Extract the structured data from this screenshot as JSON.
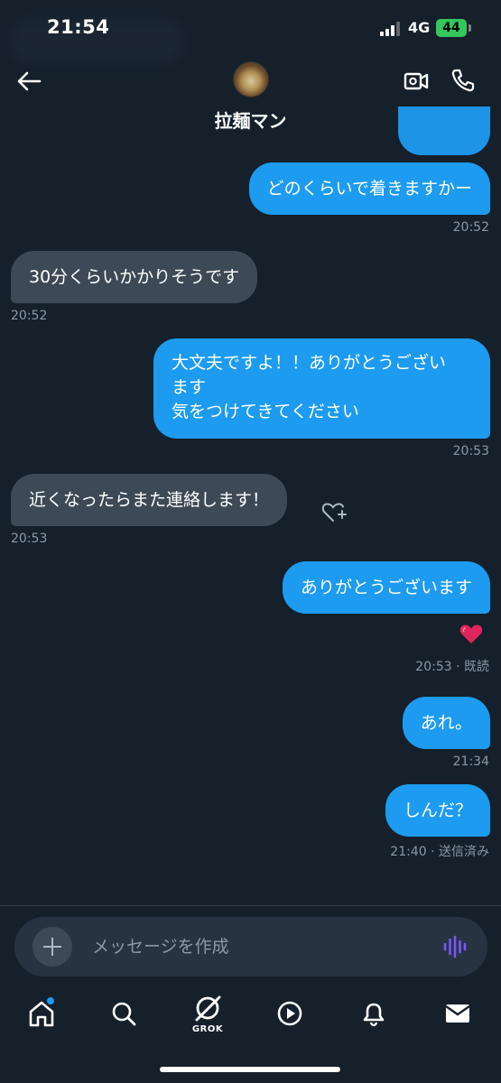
{
  "status_bar": {
    "time": "21:54",
    "network": "4G",
    "battery": "44"
  },
  "header": {
    "contact_name": "拉麺マン",
    "avatar_icon": "ramen-avatar",
    "back_icon": "arrow-left-icon",
    "video_icon": "video-call-icon",
    "phone_icon": "phone-icon"
  },
  "messages": [
    {
      "direction": "sent",
      "text": "どのくらいで着きますかー",
      "time": "20:52"
    },
    {
      "direction": "received",
      "text": "30分くらいかかりそうです",
      "time": "20:52"
    },
    {
      "direction": "sent",
      "text": "大文夫ですよ！！ありがとうござい\nます\n気をつけてきてください",
      "time": "20:53"
    },
    {
      "direction": "received",
      "text": "近くなったらまた連絡します！",
      "time": "20:53"
    },
    {
      "direction": "sent",
      "text": "ありがとうございます",
      "time": "20:53 · 既読",
      "reaction": "heart"
    },
    {
      "direction": "sent",
      "text": "あれ。",
      "time": "21:34"
    },
    {
      "direction": "sent",
      "text": "しんだ？",
      "time": "21:40 · 送信済み"
    }
  ],
  "composer": {
    "placeholder": "メッセージを作成"
  },
  "tabs": [
    {
      "name": "home",
      "icon": "home-icon"
    },
    {
      "name": "search",
      "icon": "search-icon"
    },
    {
      "name": "grok",
      "icon": "grok-icon",
      "label": "GROK"
    },
    {
      "name": "video",
      "icon": "play-icon"
    },
    {
      "name": "notifications",
      "icon": "bell-icon"
    },
    {
      "name": "messages",
      "icon": "mail-icon"
    }
  ],
  "colors": {
    "background": "#15202b",
    "sent_bubble": "#1d9bf0",
    "received_bubble": "#3d4a56",
    "accent": "#1d9bf0",
    "battery": "#34c759"
  }
}
